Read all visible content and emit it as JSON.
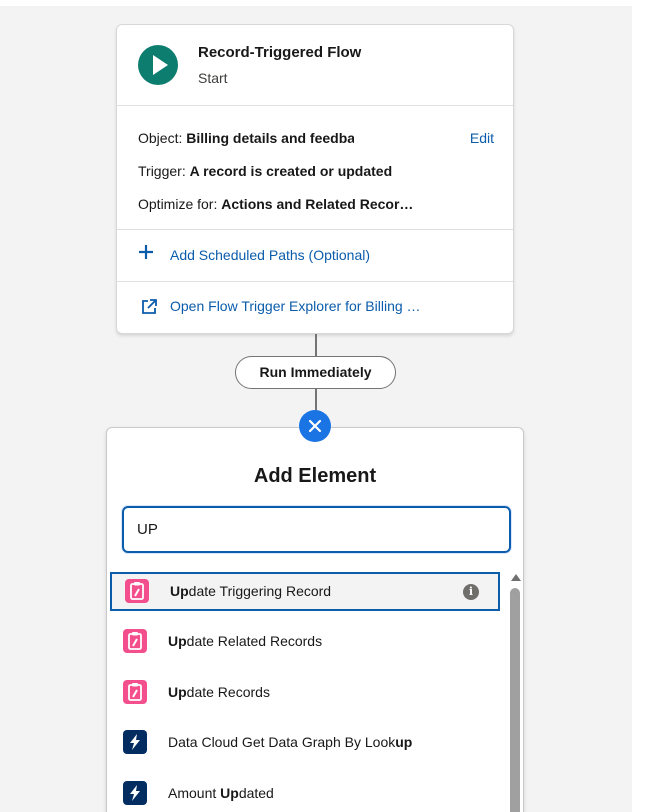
{
  "start": {
    "title": "Record-Triggered Flow",
    "subtitle": "Start",
    "object_label": "Object:",
    "object_value": "Billing details and feedback",
    "edit_label": "Edit",
    "trigger_label": "Trigger:",
    "trigger_value": "A record is created or updated",
    "optimize_label": "Optimize for:",
    "optimize_value": "Actions and Related Recor…",
    "add_paths_label": "Add Scheduled Paths (Optional)",
    "explorer_label": "Open Flow Trigger Explorer for Billing …"
  },
  "connector": {
    "path_label": "Run Immediately"
  },
  "panel": {
    "title": "Add Element",
    "search_value": "UP",
    "items": [
      {
        "bold": "Up",
        "rest": "date Triggering Record",
        "icon": "update-record-icon",
        "color": "#f34f8c"
      },
      {
        "bold": "Up",
        "rest": "date Related Records",
        "icon": "update-record-icon",
        "color": "#f34f8c"
      },
      {
        "bold": "Up",
        "rest": "date Records",
        "icon": "update-record-icon",
        "color": "#f34f8c"
      },
      {
        "pre": "Data Cloud Get Data Graph By Look",
        "bold": "up",
        "icon": "lightning-icon",
        "color": "#032d60"
      },
      {
        "pre": "Amount ",
        "bold": "Up",
        "rest": "dated",
        "icon": "lightning-icon",
        "color": "#032d60"
      }
    ],
    "info_glyph": "i"
  },
  "colors": {
    "accent": "#0b5cab",
    "start_icon": "#0d7d70",
    "close_button": "#1b74e4"
  }
}
